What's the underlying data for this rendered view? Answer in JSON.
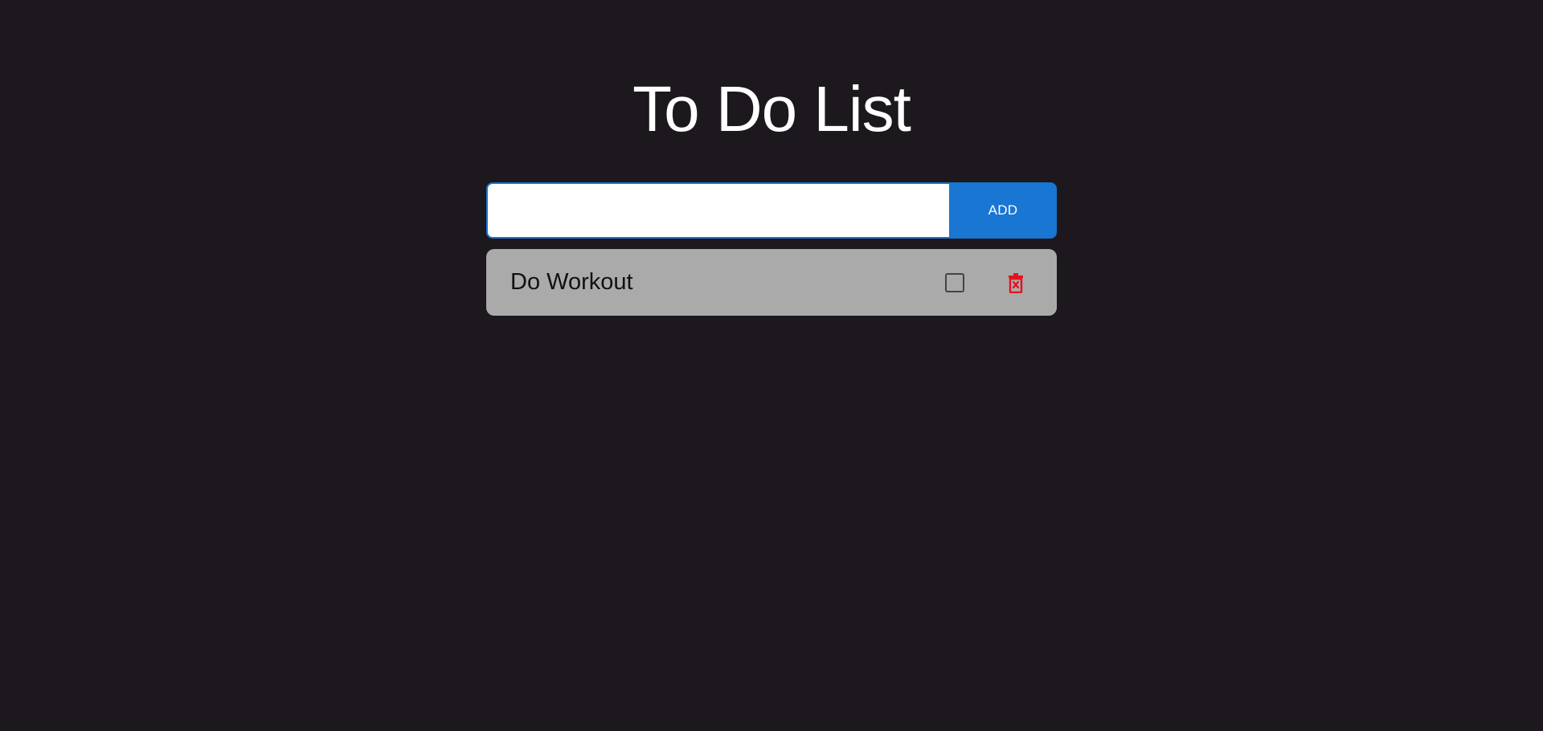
{
  "header": {
    "title": "To Do List"
  },
  "add_form": {
    "input_value": "",
    "input_placeholder": "",
    "add_label": "ADD"
  },
  "tasks": [
    {
      "text": "Do Workout",
      "completed": false
    }
  ],
  "icons": {
    "checkbox": "checkbox-unchecked-icon",
    "delete": "trash-delete-icon"
  },
  "colors": {
    "background": "#1c181e",
    "accent": "#1976d2",
    "task_background": "#aaaaaa",
    "delete": "#e8101e"
  }
}
